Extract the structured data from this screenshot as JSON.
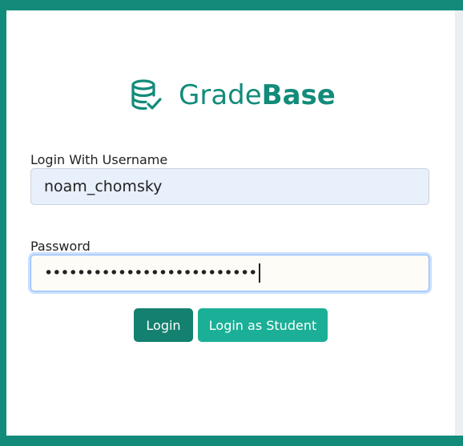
{
  "brand": {
    "name_light": "Grade",
    "name_bold": "Base",
    "icon": "database-check-icon",
    "color": "#128b7a"
  },
  "form": {
    "username_label": "Login With Username",
    "username_value": "noam_chomsky",
    "password_label": "Password",
    "password_masked": "••••••••••••••••••••••••••"
  },
  "buttons": {
    "login": "Login",
    "login_student": "Login as Student"
  },
  "colors": {
    "frame": "#128b7a",
    "login_button": "#14806f",
    "student_button": "#1aaf96",
    "username_field_bg": "#e8f0fb",
    "focus_ring": "#86b7fe"
  }
}
